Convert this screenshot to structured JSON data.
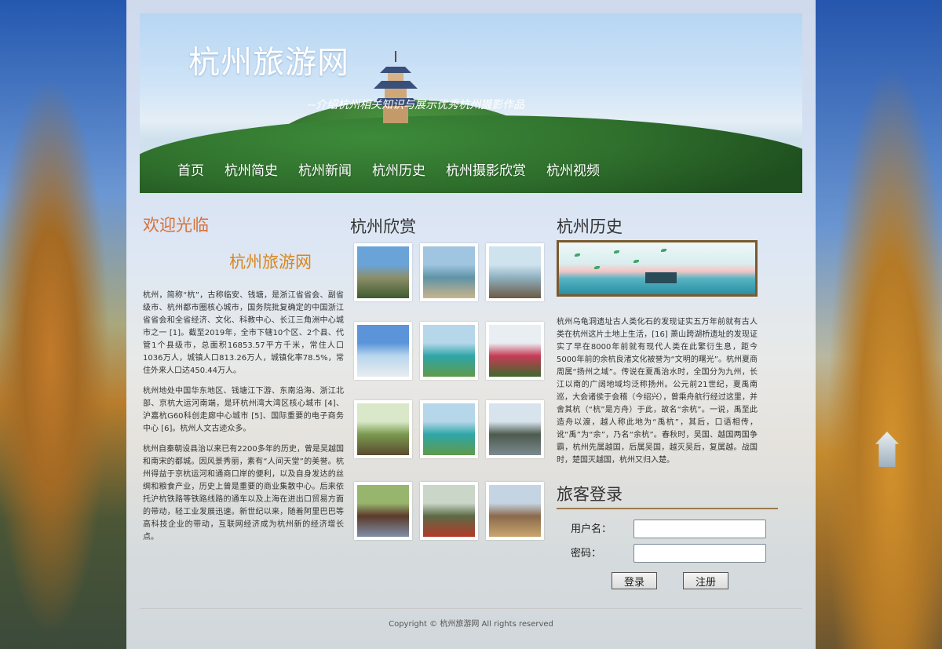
{
  "site": {
    "title": "杭州旅游网",
    "subtitle": "--介绍杭州相关知识与展示优秀杭州摄影作品"
  },
  "nav": [
    "首页",
    "杭州简史",
    "杭州新闻",
    "杭州历史",
    "杭州摄影欣赏",
    "杭州视频"
  ],
  "welcome": {
    "title": "欢迎光临",
    "subtitle": "杭州旅游网",
    "paragraphs": [
      "杭州，简称“杭”，古称临安、钱塘，是浙江省省会、副省级市、杭州都市圈核心城市，国务院批复确定的中国浙江省省会和全省经济、文化、科教中心、长江三角洲中心城市之一 [1]。截至2019年，全市下辖10个区、2个县、代管1个县级市，总面积16853.57平方千米，常住人口1036万人，城镇人口813.26万人，城镇化率78.5%，常住外来人口达450.44万人。",
      "杭州地处中国华东地区、钱塘江下游、东南沿海、浙江北部、京杭大运河南端，是环杭州湾大湾区核心城市 [4]、沪嘉杭G60科创走廊中心城市 [5]、国际重要的电子商务中心 [6]。杭州人文古迹众多。",
      "杭州自秦朝设县治以来已有2200多年的历史，曾是吴越国和南宋的都城。因风景秀丽，素有“人间天堂”的美誉。杭州得益于京杭运河和通商口岸的便利，以及自身发达的丝绸和粮食产业，历史上曾是重要的商业集散中心。后来依托沪杭铁路等铁路线路的通车以及上海在进出口贸易方面的带动，轻工业发展迅速。新世纪以来，随着阿里巴巴等高科技企业的带动，互联网经济成为杭州新的经济增长点。"
    ]
  },
  "gallery": {
    "title": "杭州欣赏",
    "photos": [
      {
        "name": "photo-rock-coast",
        "colors": [
          "#6aa3d8",
          "#8b8f6a",
          "#3f5a2d"
        ]
      },
      {
        "name": "photo-harbor-city",
        "colors": [
          "#9fc5e0",
          "#5f93a8",
          "#c9b48a"
        ]
      },
      {
        "name": "photo-island-pavilion",
        "colors": [
          "#cfe3ee",
          "#8fb0c0",
          "#6d5a45"
        ]
      },
      {
        "name": "photo-beach-waves",
        "colors": [
          "#5b94d9",
          "#b8d6ee",
          "#e8ecef"
        ]
      },
      {
        "name": "photo-lake-islands-1",
        "colors": [
          "#b6d6e9",
          "#2ea6a8",
          "#5f9a4a"
        ]
      },
      {
        "name": "photo-red-gate",
        "colors": [
          "#e8eef2",
          "#c63b55",
          "#3e6a2e"
        ]
      },
      {
        "name": "photo-village-house",
        "colors": [
          "#d9e8c8",
          "#7a9a4e",
          "#5a4a30"
        ]
      },
      {
        "name": "photo-lake-islands-2",
        "colors": [
          "#b6d6e9",
          "#2ea6a8",
          "#5f9a4a"
        ]
      },
      {
        "name": "photo-lakeside-pagoda",
        "colors": [
          "#d7e4ee",
          "#4d5a4f",
          "#7b8a8f"
        ]
      },
      {
        "name": "photo-old-gate-crowd",
        "colors": [
          "#98b56e",
          "#5b3a2a",
          "#7f8fa8"
        ]
      },
      {
        "name": "photo-stone-monument",
        "colors": [
          "#c9d6c8",
          "#5d6a45",
          "#b23a2a"
        ]
      },
      {
        "name": "photo-cliff-temple",
        "colors": [
          "#c4d4e2",
          "#8a6a4c",
          "#c9a56f"
        ]
      }
    ]
  },
  "history": {
    "title": "杭州历史",
    "text": "杭州乌龟洞遗址古人类化石的发现证实五万年前就有古人类在杭州这片土地上生活，[16] 萧山跨湖桥遗址的发现证实了早在8000年前就有现代人类在此繁衍生息，距今5000年前的余杭良渚文化被誉为“文明的曙光”。杭州夏商周属“扬州之域”。传说在夏禹治水时，全国分为九州，长江以南的广阔地域均泛称扬州。公元前21世纪，夏禹南巡，大会诸侯于会稽（今绍兴），曾乘舟航行经过这里，并舍其杭（“杭”是方舟）于此，故名“余杭”。一说，禹至此造舟以渡，越人称此地为“禹杭”，其后，口语相传，讹“禹”为“余”，乃名“余杭”。春秋时，吴国、越国两国争霸，杭州先属越国，后属吴国，越灭吴后，复属越。战国时，楚国灭越国，杭州又归入楚。"
  },
  "login": {
    "title": "旅客登录",
    "username_label": "用户名：",
    "password_label": "密码：",
    "username_value": "",
    "password_value": "",
    "login_button": "登录",
    "register_button": "注册"
  },
  "footer": {
    "text": "Copyright © 杭州旅游网 All rights reserved"
  },
  "colors": {
    "welcome_title": "#d9703a",
    "welcome_subtitle": "#d8861e",
    "history_frame": "#7a5a2e"
  }
}
